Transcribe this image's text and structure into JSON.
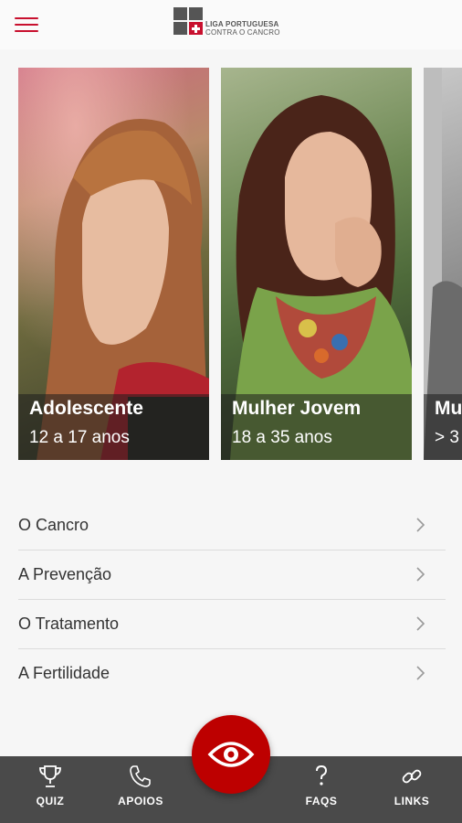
{
  "header": {
    "logo_line1": "LIGA PORTUGUESA",
    "logo_line2": "CONTRA O CANCRO"
  },
  "cards": [
    {
      "title": "Adolescente",
      "subtitle": "12 a 17 anos"
    },
    {
      "title": "Mulher Jovem",
      "subtitle": "18 a 35 anos"
    },
    {
      "title": "Mu",
      "subtitle": "> 3"
    }
  ],
  "menu": {
    "items": [
      {
        "label": "O Cancro"
      },
      {
        "label": "A Prevenção"
      },
      {
        "label": "O Tratamento"
      },
      {
        "label": "A Fertilidade"
      }
    ]
  },
  "bottom_nav": {
    "quiz": "QUIZ",
    "apoios": "APOIOS",
    "faqs": "FAQS",
    "links": "LINKS"
  },
  "colors": {
    "accent": "#c8102e",
    "fab": "#bd0000",
    "nav_bg": "#4a4a4a"
  },
  "icons": {
    "menu": "hamburger-icon",
    "chevron": "chevron-right-icon",
    "quiz": "trophy-icon",
    "apoios": "phone-icon",
    "fab": "eye-icon",
    "faqs": "question-icon",
    "links": "link-icon"
  }
}
